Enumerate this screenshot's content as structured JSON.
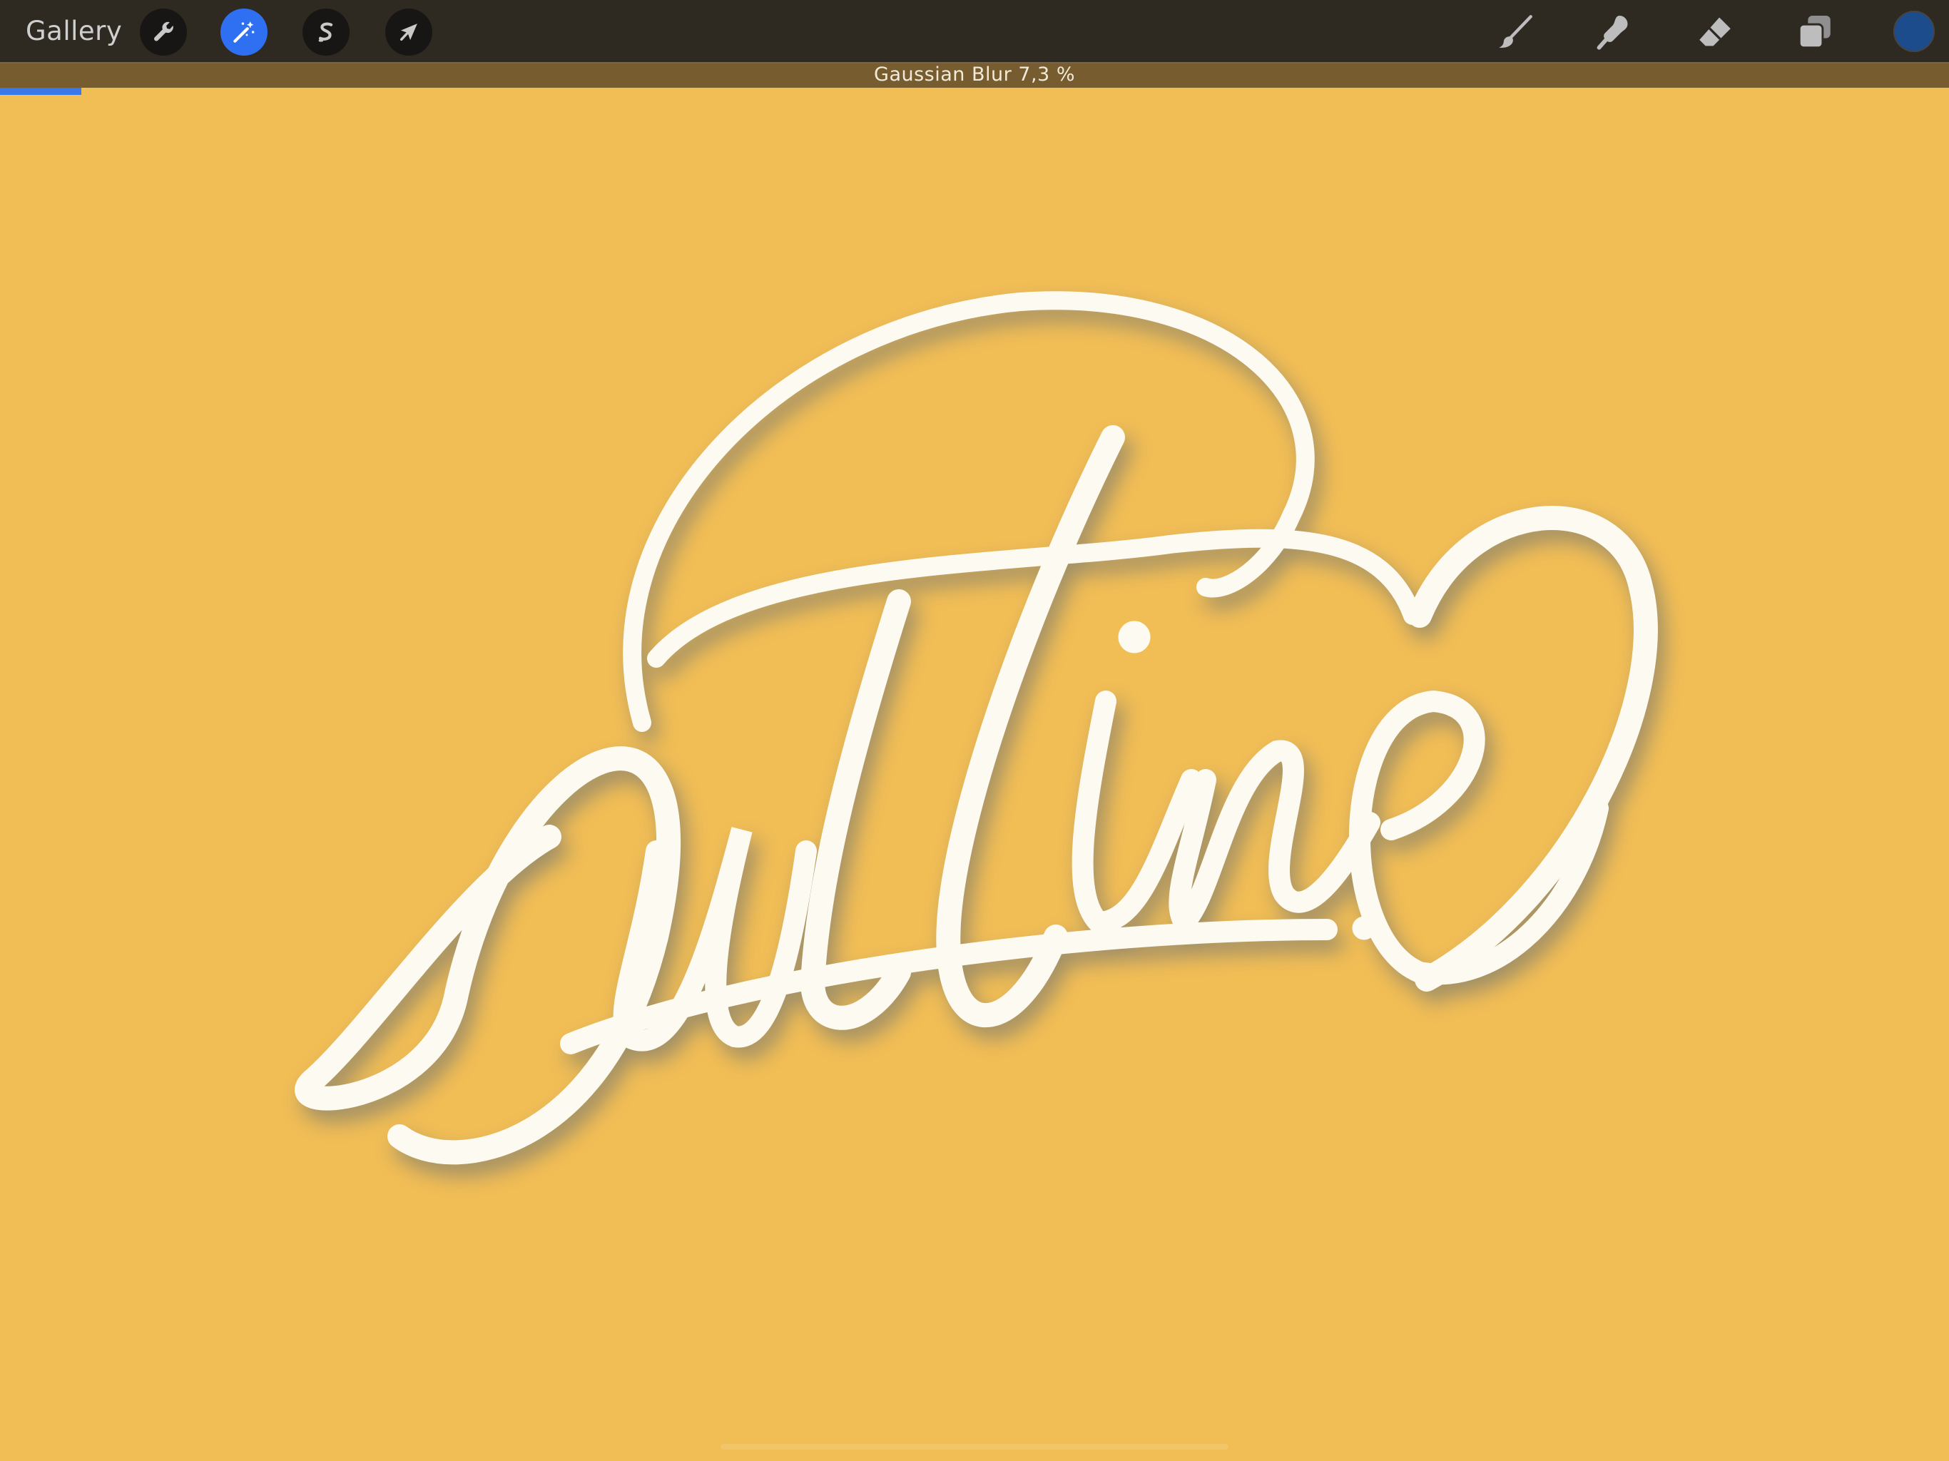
{
  "toolbar": {
    "gallery_label": "Gallery",
    "tools": [
      {
        "id": "actions",
        "icon": "wrench-icon",
        "active": false
      },
      {
        "id": "adjustments",
        "icon": "magic-wand-icon",
        "active": true
      },
      {
        "id": "selection",
        "icon": "selection-s-icon",
        "active": false
      },
      {
        "id": "transform",
        "icon": "arrow-cursor-icon",
        "active": false
      }
    ],
    "right_tools": [
      {
        "id": "brush",
        "icon": "brush-icon"
      },
      {
        "id": "smudge",
        "icon": "smudge-icon"
      },
      {
        "id": "eraser",
        "icon": "eraser-icon"
      },
      {
        "id": "layers",
        "icon": "layers-icon"
      }
    ],
    "current_color": "#1d4c8c"
  },
  "adjustment": {
    "label": "Gaussian Blur 7,3 %",
    "progress_percent": 7.3
  },
  "canvas": {
    "background_color": "#f1bd55",
    "artwork_text": "Outline",
    "artwork_fill": "#fdfaf2",
    "artwork_shadow": "#5f6a75"
  },
  "colors": {
    "toolbar_bg": "#2e2a22",
    "adjust_bar_bg": "#775c30",
    "accent": "#2f6ff2"
  }
}
